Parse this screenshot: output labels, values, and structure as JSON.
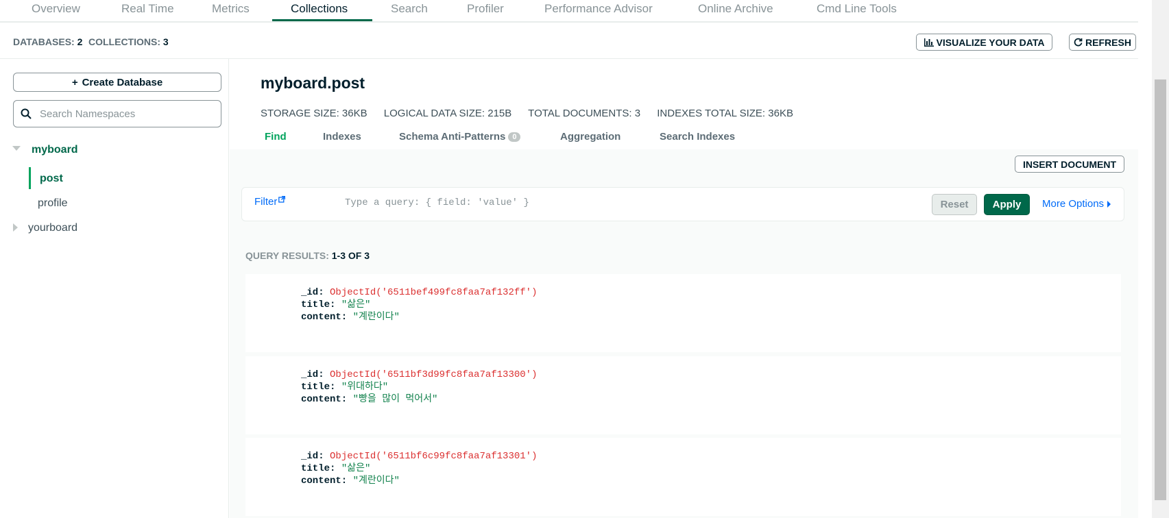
{
  "nav": {
    "tabs": [
      {
        "label": "Overview"
      },
      {
        "label": "Real Time"
      },
      {
        "label": "Metrics"
      },
      {
        "label": "Collections"
      },
      {
        "label": "Search"
      },
      {
        "label": "Profiler"
      },
      {
        "label": "Performance Advisor"
      },
      {
        "label": "Online Archive"
      },
      {
        "label": "Cmd Line Tools"
      }
    ],
    "active_tab": "Collections"
  },
  "stats": {
    "databases_label": "DATABASES:",
    "databases_value": "2",
    "collections_label": "COLLECTIONS:",
    "collections_value": "3",
    "visualize_label": "VISUALIZE YOUR DATA",
    "refresh_label": "REFRESH"
  },
  "sidebar": {
    "create_db_label": "Create Database",
    "search_placeholder": "Search Namespaces",
    "databases": [
      {
        "name": "myboard",
        "expanded": true,
        "collections": [
          "post",
          "profile"
        ]
      },
      {
        "name": "yourboard",
        "expanded": false
      }
    ],
    "active_collection": "post"
  },
  "collection": {
    "title": "myboard.post",
    "storage_size": "STORAGE SIZE: 36KB",
    "logical_size": "LOGICAL DATA SIZE: 215B",
    "total_documents": "TOTAL DOCUMENTS: 3",
    "indexes_size": "INDEXES TOTAL SIZE: 36KB",
    "tabs": [
      {
        "label": "Find"
      },
      {
        "label": "Indexes"
      },
      {
        "label": "Schema Anti-Patterns",
        "badge": "0"
      },
      {
        "label": "Aggregation"
      },
      {
        "label": "Search Indexes"
      }
    ],
    "active_tab": "Find"
  },
  "query": {
    "insert_label": "INSERT DOCUMENT",
    "filter_label": "Filter",
    "placeholder": "Type a query: { field: 'value' }",
    "reset_label": "Reset",
    "apply_label": "Apply",
    "more_options_label": "More Options"
  },
  "results": {
    "label": "QUERY RESULTS:",
    "range": "1-3 OF 3",
    "documents": [
      {
        "id": "ObjectId('6511bef499fc8faa7af132ff')",
        "title": "\"삶은\"",
        "content": "\"계란이다\""
      },
      {
        "id": "ObjectId('6511bf3d99fc8faa7af13300')",
        "title": "\"위대하다\"",
        "content": "\"빵을 많이 먹어서\""
      },
      {
        "id": "ObjectId('6511bf6c99fc8faa7af13301')",
        "title": "\"삶은\"",
        "content": "\"계란이다\""
      }
    ]
  },
  "colors": {
    "accent_green": "#00684a",
    "active_green": "#00a35c",
    "link_blue": "#016bf8",
    "oid_red": "#db3030",
    "string_green": "#12824d"
  }
}
